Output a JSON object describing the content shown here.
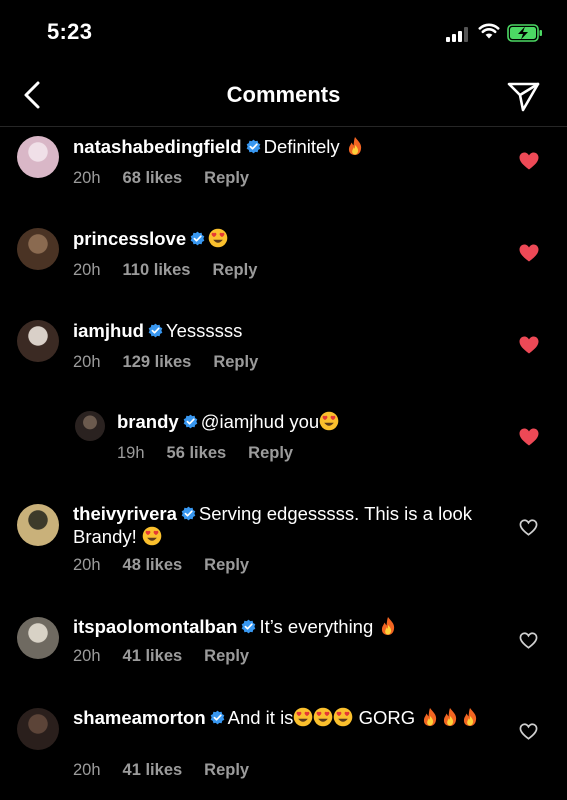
{
  "status_bar": {
    "time": "5:23"
  },
  "header": {
    "title": "Comments",
    "back_icon": "chevron-left-icon",
    "share_icon": "paper-plane-icon"
  },
  "colors": {
    "background": "#000000",
    "like_red": "#ed4956",
    "verified_blue": "#3897f0",
    "meta_gray": "#9b9b9b"
  },
  "comments": [
    {
      "username": "natashabedingfield",
      "verified": true,
      "text": "Definitely ",
      "emojis": [
        "fire"
      ],
      "time": "20h",
      "likes": "68 likes",
      "reply": "Reply",
      "liked": true
    },
    {
      "username": "princesslove",
      "verified": true,
      "text": "",
      "emojis": [
        "heart-eyes"
      ],
      "time": "20h",
      "likes": "110 likes",
      "reply": "Reply",
      "liked": true
    },
    {
      "username": "iamjhud",
      "verified": true,
      "text": "Yessssss",
      "emojis": [],
      "time": "20h",
      "likes": "129 likes",
      "reply": "Reply",
      "liked": true
    },
    {
      "username": "brandy",
      "verified": true,
      "text": "@iamjhud you",
      "emojis": [
        "heart-eyes"
      ],
      "time": "19h",
      "likes": "56 likes",
      "reply": "Reply",
      "liked": true,
      "is_reply": true
    },
    {
      "username": "theivyrivera",
      "verified": true,
      "text": "Serving edgesssss. This is a look Brandy! ",
      "emojis": [
        "heart-eyes"
      ],
      "time": "20h",
      "likes": "48 likes",
      "reply": "Reply",
      "liked": false
    },
    {
      "username": "itspaolomontalban",
      "verified": true,
      "text": "It’s everything ",
      "emojis": [
        "fire"
      ],
      "time": "20h",
      "likes": "41 likes",
      "reply": "Reply",
      "liked": false
    },
    {
      "username": "shameamorton",
      "verified": true,
      "text": "And it is",
      "emojis": [
        "heart-eyes",
        "heart-eyes",
        "heart-eyes"
      ],
      "text2": " GORG ",
      "emojis2": [
        "fire",
        "fire",
        "fire"
      ],
      "time": "20h",
      "likes": "41 likes",
      "reply": "Reply",
      "liked": false
    }
  ]
}
